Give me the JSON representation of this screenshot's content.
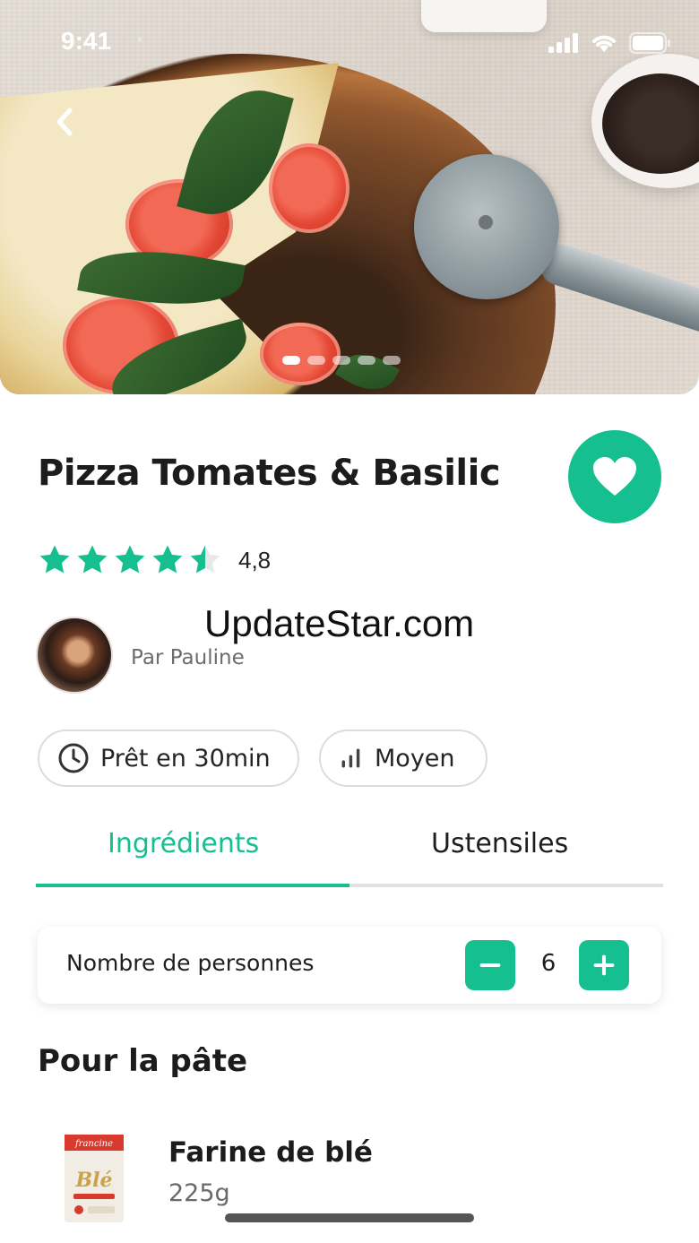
{
  "status_bar": {
    "time": "9:41"
  },
  "hero": {
    "carousel_count": 5,
    "carousel_active_index": 0
  },
  "recipe": {
    "title": "Pizza Tomates & Basilic",
    "rating_value": "4,8",
    "rating_stars": 4.5,
    "author": "Par Pauline",
    "watermark": "UpdateStar.com"
  },
  "chips": {
    "time_label": "Prêt en 30min",
    "difficulty_label": "Moyen"
  },
  "tabs": [
    {
      "label": "Ingrédients",
      "active": true
    },
    {
      "label": "Ustensiles",
      "active": false
    }
  ],
  "servings": {
    "label": "Nombre de personnes",
    "count": "6"
  },
  "sections": [
    {
      "title": "Pour la pâte",
      "ingredients": [
        {
          "name": "Farine de blé",
          "quantity": "225g",
          "package_brand": "francine",
          "package_text": "Blé"
        }
      ]
    }
  ],
  "colors": {
    "accent": "#16bf8f",
    "text": "#1c1c1c",
    "muted": "#6a6a6a"
  }
}
